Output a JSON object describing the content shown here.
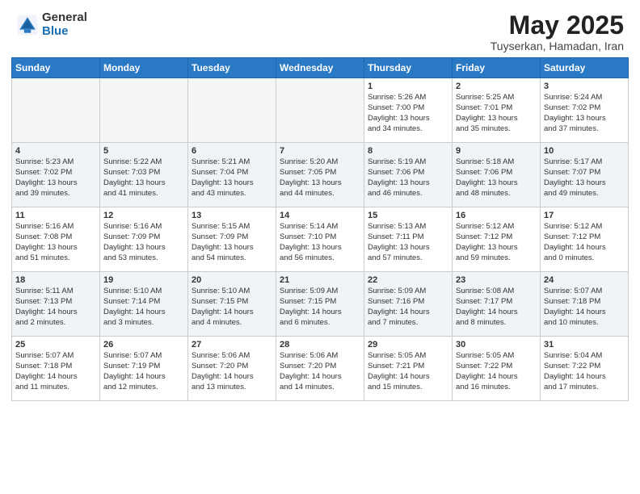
{
  "header": {
    "logo_line1": "General",
    "logo_line2": "Blue",
    "month": "May 2025",
    "location": "Tuyserkan, Hamadan, Iran"
  },
  "days_of_week": [
    "Sunday",
    "Monday",
    "Tuesday",
    "Wednesday",
    "Thursday",
    "Friday",
    "Saturday"
  ],
  "weeks": [
    [
      {
        "day": "",
        "info": ""
      },
      {
        "day": "",
        "info": ""
      },
      {
        "day": "",
        "info": ""
      },
      {
        "day": "",
        "info": ""
      },
      {
        "day": "1",
        "info": "Sunrise: 5:26 AM\nSunset: 7:00 PM\nDaylight: 13 hours\nand 34 minutes."
      },
      {
        "day": "2",
        "info": "Sunrise: 5:25 AM\nSunset: 7:01 PM\nDaylight: 13 hours\nand 35 minutes."
      },
      {
        "day": "3",
        "info": "Sunrise: 5:24 AM\nSunset: 7:02 PM\nDaylight: 13 hours\nand 37 minutes."
      }
    ],
    [
      {
        "day": "4",
        "info": "Sunrise: 5:23 AM\nSunset: 7:02 PM\nDaylight: 13 hours\nand 39 minutes."
      },
      {
        "day": "5",
        "info": "Sunrise: 5:22 AM\nSunset: 7:03 PM\nDaylight: 13 hours\nand 41 minutes."
      },
      {
        "day": "6",
        "info": "Sunrise: 5:21 AM\nSunset: 7:04 PM\nDaylight: 13 hours\nand 43 minutes."
      },
      {
        "day": "7",
        "info": "Sunrise: 5:20 AM\nSunset: 7:05 PM\nDaylight: 13 hours\nand 44 minutes."
      },
      {
        "day": "8",
        "info": "Sunrise: 5:19 AM\nSunset: 7:06 PM\nDaylight: 13 hours\nand 46 minutes."
      },
      {
        "day": "9",
        "info": "Sunrise: 5:18 AM\nSunset: 7:06 PM\nDaylight: 13 hours\nand 48 minutes."
      },
      {
        "day": "10",
        "info": "Sunrise: 5:17 AM\nSunset: 7:07 PM\nDaylight: 13 hours\nand 49 minutes."
      }
    ],
    [
      {
        "day": "11",
        "info": "Sunrise: 5:16 AM\nSunset: 7:08 PM\nDaylight: 13 hours\nand 51 minutes."
      },
      {
        "day": "12",
        "info": "Sunrise: 5:16 AM\nSunset: 7:09 PM\nDaylight: 13 hours\nand 53 minutes."
      },
      {
        "day": "13",
        "info": "Sunrise: 5:15 AM\nSunset: 7:09 PM\nDaylight: 13 hours\nand 54 minutes."
      },
      {
        "day": "14",
        "info": "Sunrise: 5:14 AM\nSunset: 7:10 PM\nDaylight: 13 hours\nand 56 minutes."
      },
      {
        "day": "15",
        "info": "Sunrise: 5:13 AM\nSunset: 7:11 PM\nDaylight: 13 hours\nand 57 minutes."
      },
      {
        "day": "16",
        "info": "Sunrise: 5:12 AM\nSunset: 7:12 PM\nDaylight: 13 hours\nand 59 minutes."
      },
      {
        "day": "17",
        "info": "Sunrise: 5:12 AM\nSunset: 7:12 PM\nDaylight: 14 hours\nand 0 minutes."
      }
    ],
    [
      {
        "day": "18",
        "info": "Sunrise: 5:11 AM\nSunset: 7:13 PM\nDaylight: 14 hours\nand 2 minutes."
      },
      {
        "day": "19",
        "info": "Sunrise: 5:10 AM\nSunset: 7:14 PM\nDaylight: 14 hours\nand 3 minutes."
      },
      {
        "day": "20",
        "info": "Sunrise: 5:10 AM\nSunset: 7:15 PM\nDaylight: 14 hours\nand 4 minutes."
      },
      {
        "day": "21",
        "info": "Sunrise: 5:09 AM\nSunset: 7:15 PM\nDaylight: 14 hours\nand 6 minutes."
      },
      {
        "day": "22",
        "info": "Sunrise: 5:09 AM\nSunset: 7:16 PM\nDaylight: 14 hours\nand 7 minutes."
      },
      {
        "day": "23",
        "info": "Sunrise: 5:08 AM\nSunset: 7:17 PM\nDaylight: 14 hours\nand 8 minutes."
      },
      {
        "day": "24",
        "info": "Sunrise: 5:07 AM\nSunset: 7:18 PM\nDaylight: 14 hours\nand 10 minutes."
      }
    ],
    [
      {
        "day": "25",
        "info": "Sunrise: 5:07 AM\nSunset: 7:18 PM\nDaylight: 14 hours\nand 11 minutes."
      },
      {
        "day": "26",
        "info": "Sunrise: 5:07 AM\nSunset: 7:19 PM\nDaylight: 14 hours\nand 12 minutes."
      },
      {
        "day": "27",
        "info": "Sunrise: 5:06 AM\nSunset: 7:20 PM\nDaylight: 14 hours\nand 13 minutes."
      },
      {
        "day": "28",
        "info": "Sunrise: 5:06 AM\nSunset: 7:20 PM\nDaylight: 14 hours\nand 14 minutes."
      },
      {
        "day": "29",
        "info": "Sunrise: 5:05 AM\nSunset: 7:21 PM\nDaylight: 14 hours\nand 15 minutes."
      },
      {
        "day": "30",
        "info": "Sunrise: 5:05 AM\nSunset: 7:22 PM\nDaylight: 14 hours\nand 16 minutes."
      },
      {
        "day": "31",
        "info": "Sunrise: 5:04 AM\nSunset: 7:22 PM\nDaylight: 14 hours\nand 17 minutes."
      }
    ]
  ]
}
